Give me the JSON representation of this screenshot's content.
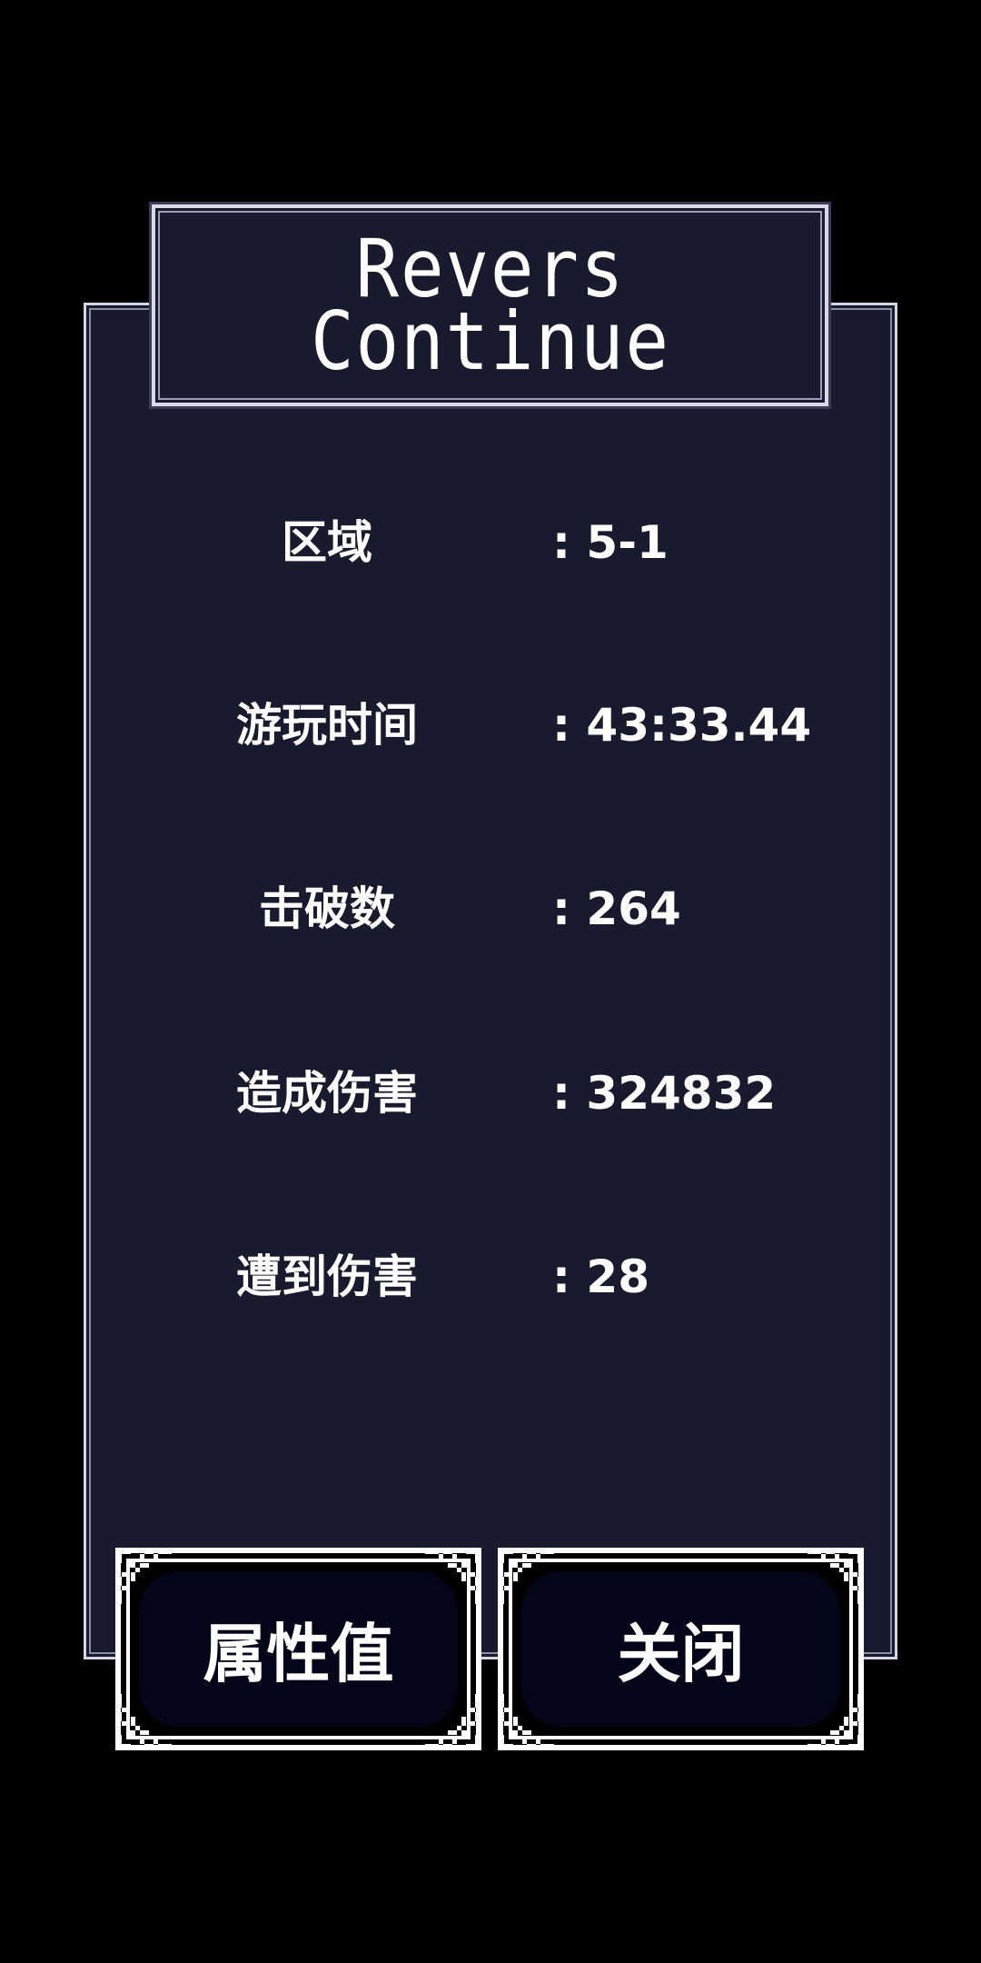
{
  "title": {
    "line1": "Revers",
    "line2": "Continue"
  },
  "stats": [
    {
      "label": "区域",
      "value": ": 5-1"
    },
    {
      "label": "游玩时间",
      "value": ": 43:33.44"
    },
    {
      "label": "击破数",
      "value": ": 264"
    },
    {
      "label": "造成伤害",
      "value": ": 324832"
    },
    {
      "label": "遭到伤害",
      "value": ": 28"
    }
  ],
  "buttons": {
    "attributes_label": "属性值",
    "close_label": "关闭"
  },
  "colors": {
    "background": "#000000",
    "panel": "#1a1a2e",
    "panel_border": "#d3d6e4",
    "text": "#ffffff",
    "button_fill": "#05051a"
  },
  "icons": [
    "ornate-corner-icon"
  ]
}
